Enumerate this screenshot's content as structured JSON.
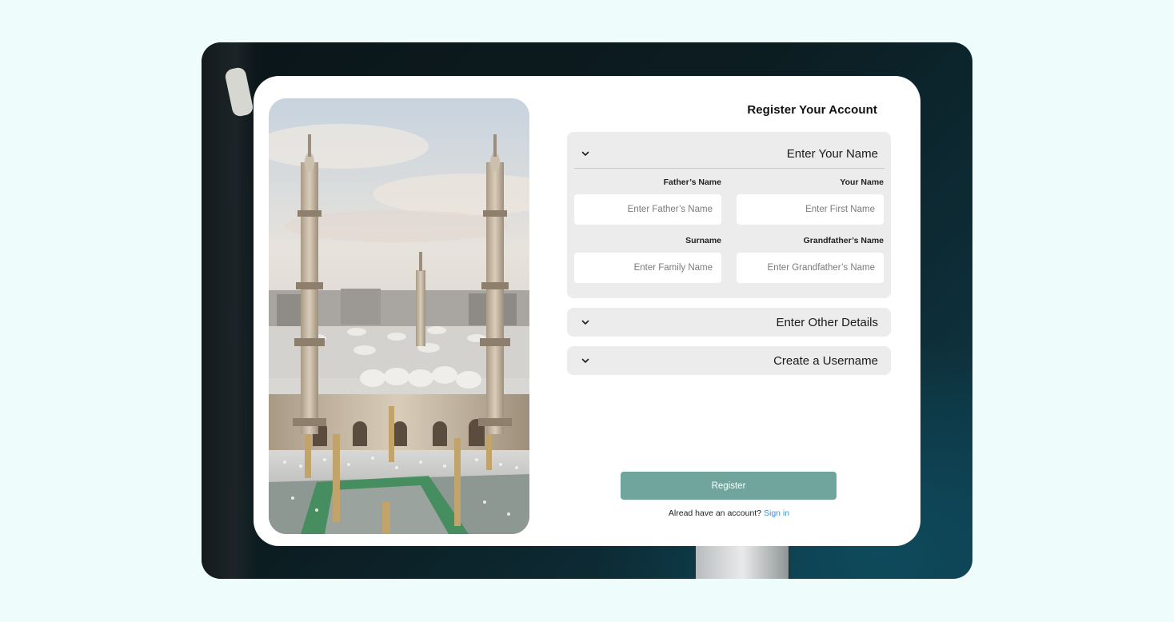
{
  "page": {
    "title": "Register Your Account"
  },
  "sections": {
    "name": {
      "header": "Enter Your Name",
      "icon": "chevron-down-icon",
      "fields": {
        "fathers_name": {
          "label": "Father’s Name",
          "placeholder": "Enter Father’s Name"
        },
        "your_name": {
          "label": "Your Name",
          "placeholder": "Enter First Name"
        },
        "surname": {
          "label": "Surname",
          "placeholder": "Enter Family Name"
        },
        "grandfathers_name": {
          "label": "Grandfather’s Name",
          "placeholder": "Enter Grandfather’s Name"
        }
      }
    },
    "other_details": {
      "header": "Enter Other Details",
      "icon": "chevron-down-icon"
    },
    "username": {
      "header": "Create a Username",
      "icon": "chevron-down-icon"
    }
  },
  "actions": {
    "register_label": "Register",
    "signin_prompt": "Alread have an account?",
    "signin_link": "Sign in"
  },
  "colors": {
    "page_bg": "#effcfc",
    "panel_bg": "#ececec",
    "button": "#6fa59c",
    "link": "#3b8ee0"
  }
}
